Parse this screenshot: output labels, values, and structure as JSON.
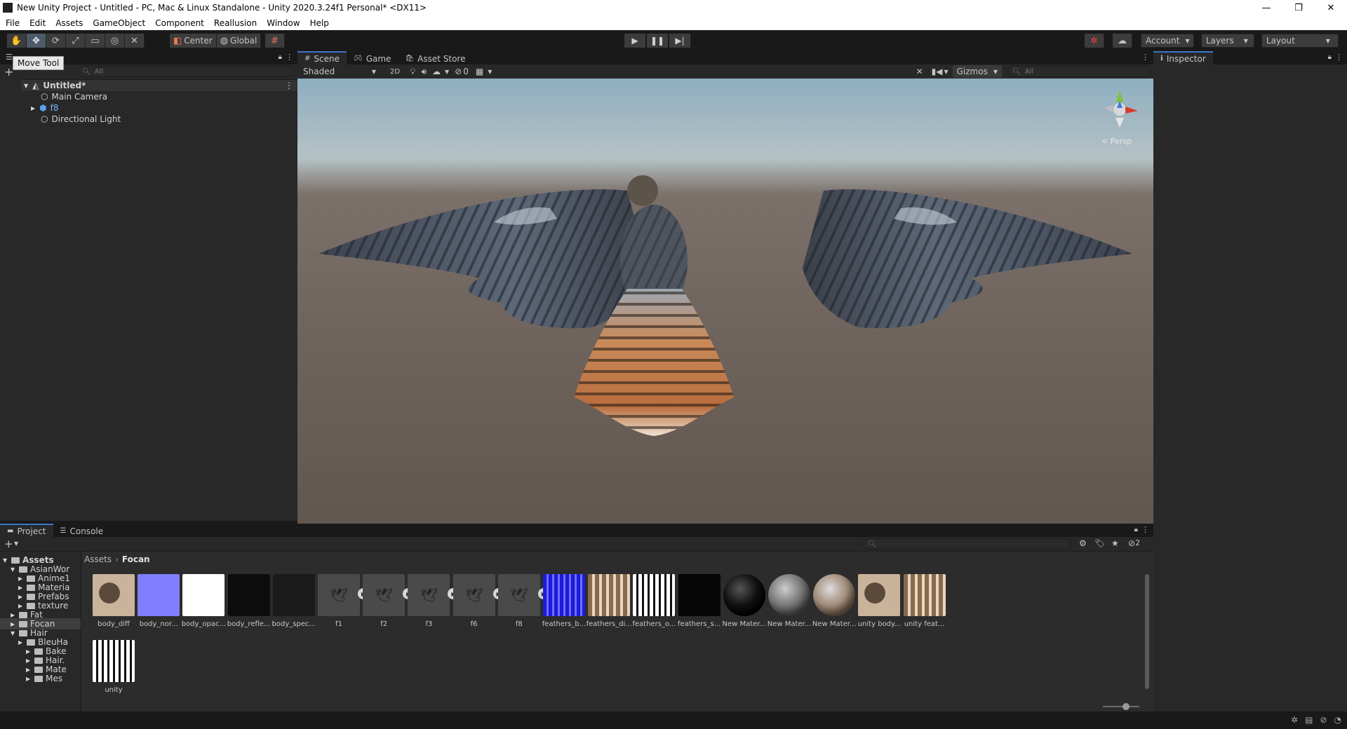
{
  "window": {
    "title": "New Unity Project - Untitled - PC, Mac & Linux Standalone - Unity 2020.3.24f1 Personal* <DX11>",
    "controls": [
      "—",
      "❐",
      "✕"
    ]
  },
  "menu": [
    "File",
    "Edit",
    "Assets",
    "GameObject",
    "Component",
    "Reallusion",
    "Window",
    "Help"
  ],
  "toolbar": {
    "pivot_label": "Center",
    "space_label": "Global",
    "account_label": "Account",
    "layers_label": "Layers",
    "layout_label": "Layout"
  },
  "hierarchy": {
    "tooltip": "Move Tool",
    "search_placeholder": "All",
    "scene_name": "Untitled*",
    "items": [
      "Main Camera",
      "f8",
      "Directional Light"
    ]
  },
  "scene": {
    "tabs": [
      "Scene",
      "Game",
      "Asset Store"
    ],
    "shading_mode": "Shaded",
    "mode_2d": "2D",
    "hidden_count": "0",
    "gizmos_label": "Gizmos",
    "search_placeholder": "All",
    "projection_label": "< Persp"
  },
  "inspector": {
    "tab": "Inspector"
  },
  "project": {
    "tabs": [
      "Project",
      "Console"
    ],
    "hidden_count": "2",
    "breadcrumb": [
      "Assets",
      "Focan"
    ],
    "tree": [
      {
        "label": "Assets",
        "indent": 0,
        "bold": true
      },
      {
        "label": "AsianWor",
        "indent": 1
      },
      {
        "label": "Anime1",
        "indent": 2
      },
      {
        "label": "Materia",
        "indent": 2
      },
      {
        "label": "Prefabs",
        "indent": 2
      },
      {
        "label": "texture",
        "indent": 2
      },
      {
        "label": "Fat",
        "indent": 1
      },
      {
        "label": "Focan",
        "indent": 1,
        "selected": true
      },
      {
        "label": "Hair",
        "indent": 1
      },
      {
        "label": "BleuHa",
        "indent": 2
      },
      {
        "label": "Bake",
        "indent": 3
      },
      {
        "label": "Hair.",
        "indent": 3
      },
      {
        "label": "Mate",
        "indent": 3
      },
      {
        "label": "Mes",
        "indent": 3
      }
    ],
    "assets": [
      {
        "name": "body_diff",
        "kind": "tex-body"
      },
      {
        "name": "body_nor...",
        "kind": "tex-normal"
      },
      {
        "name": "body_opac...",
        "kind": "tex-white"
      },
      {
        "name": "body_refle...",
        "kind": "tex-dark"
      },
      {
        "name": "body_spec...",
        "kind": "tex-dark2"
      },
      {
        "name": "f1",
        "kind": "model"
      },
      {
        "name": "f2",
        "kind": "model"
      },
      {
        "name": "f3",
        "kind": "model"
      },
      {
        "name": "f6",
        "kind": "model"
      },
      {
        "name": "f8",
        "kind": "model"
      },
      {
        "name": "feathers_b...",
        "kind": "tex-blue"
      },
      {
        "name": "feathers_di...",
        "kind": "tex-feather"
      },
      {
        "name": "feathers_o...",
        "kind": "tex-opacity"
      },
      {
        "name": "feathers_s...",
        "kind": "tex-black"
      },
      {
        "name": "New Mater...",
        "kind": "mat-black"
      },
      {
        "name": "New Mater...",
        "kind": "mat-grey"
      },
      {
        "name": "New Mater...",
        "kind": "mat-tan"
      },
      {
        "name": "unity body...",
        "kind": "tex-body"
      },
      {
        "name": "unity feat...",
        "kind": "tex-feather"
      },
      {
        "name": "unity",
        "kind": "tex-opacity"
      }
    ]
  },
  "colors": {
    "accent": "#3a78c6",
    "panel": "#282828",
    "dark": "#191919"
  }
}
